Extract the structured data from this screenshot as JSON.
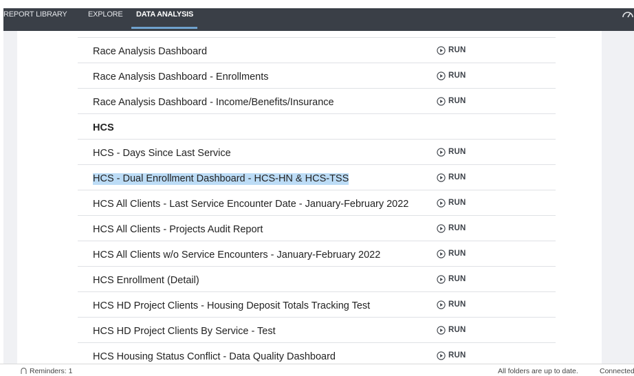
{
  "nav": {
    "tabs": [
      {
        "label": "REPORT LIBRARY"
      },
      {
        "label": "EXPLORE"
      },
      {
        "label": "DATA ANALYSIS"
      }
    ],
    "gauge_icon": "dashboard-gauge-icon"
  },
  "reports": {
    "run_label": "RUN",
    "rows": [
      {
        "label": "Race Analysis Dashboard",
        "type": "report"
      },
      {
        "label": "Race Analysis Dashboard - Enrollments",
        "type": "report"
      },
      {
        "label": "Race Analysis Dashboard - Income/Benefits/Insurance",
        "type": "report"
      },
      {
        "label": "HCS",
        "type": "header"
      },
      {
        "label": "HCS - Days Since Last Service",
        "type": "report"
      },
      {
        "label": "HCS - Dual Enrollment Dashboard - HCS-HN & HCS-TSS",
        "type": "report",
        "selected": true
      },
      {
        "label": "HCS All Clients - Last Service Encounter Date - January-February 2022",
        "type": "report"
      },
      {
        "label": "HCS All Clients - Projects Audit Report",
        "type": "report"
      },
      {
        "label": "HCS All Clients w/o Service Encounters - January-February 2022",
        "type": "report"
      },
      {
        "label": "HCS Enrollment (Detail)",
        "type": "report"
      },
      {
        "label": "HCS HD Project Clients - Housing Deposit Totals Tracking Test",
        "type": "report"
      },
      {
        "label": "HCS HD Project Clients By Service - Test",
        "type": "report"
      },
      {
        "label": "HCS Housing Status Conflict - Data Quality Dashboard",
        "type": "report"
      }
    ]
  },
  "statusbar": {
    "reminders": "Reminders: 1",
    "folders": "All folders are up to date.",
    "connection": "Connected"
  },
  "colors": {
    "navbar": "#3a3f47",
    "nav_active_underline": "#6fa2cf",
    "selection_highlight": "#bcdcf6",
    "page_background": "#f0f1f4"
  }
}
